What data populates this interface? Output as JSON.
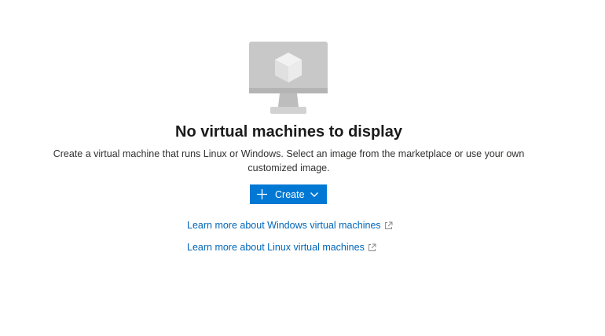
{
  "empty_state": {
    "icon": "virtual-machine-icon",
    "title": "No virtual machines to display",
    "description": "Create a virtual machine that runs Linux or Windows. Select an image from the marketplace or use your own customized image.",
    "create_button": {
      "label": "Create",
      "icon": "plus-icon",
      "dropdown_icon": "chevron-down-icon",
      "color": "#0078d4"
    },
    "links": [
      {
        "label": "Learn more about Windows virtual machines",
        "icon": "external-link-icon"
      },
      {
        "label": "Learn more about Linux virtual machines",
        "icon": "external-link-icon"
      }
    ],
    "link_color": "#0066b8"
  }
}
